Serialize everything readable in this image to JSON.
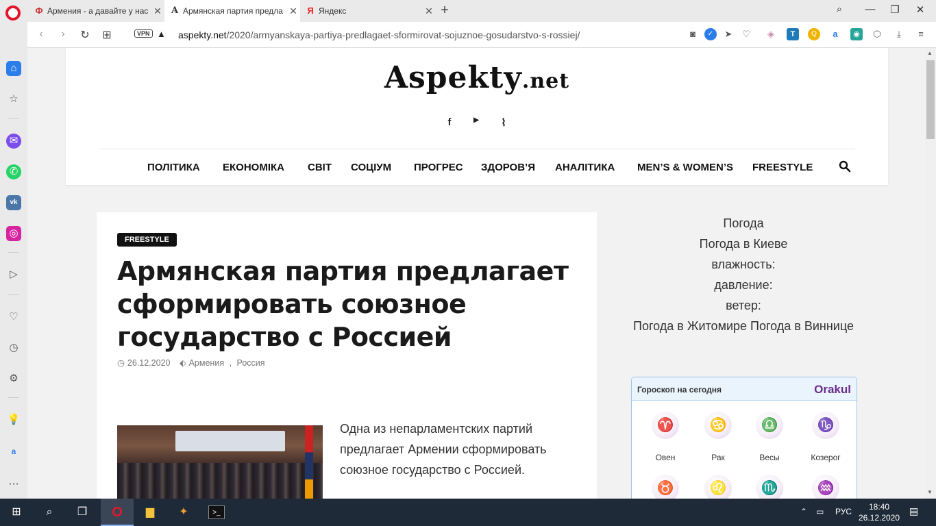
{
  "browser": {
    "tabs": [
      {
        "title": "Армения - а давайте у нас",
        "favicon": "Ф"
      },
      {
        "title": "Армянская партия предла",
        "favicon": "A"
      },
      {
        "title": "Яндекс",
        "favicon": "Я"
      }
    ],
    "new_tab": "+",
    "address": {
      "vpn": "VPN",
      "domain": "aspekty.net",
      "path": "/2020/armyanskaya-partiya-predlagaet-sformirovat-sojuznoe-gosudarstvo-s-rossiej/"
    }
  },
  "site": {
    "logo_main": "Aspekty",
    "logo_tld": ".net",
    "menu": [
      "ПОЛІТИКА",
      "ЕКОНОМІКА",
      "СВІТ",
      "СОЦІУМ",
      "ПРОГРЕС",
      "ЗДОРОВ’Я",
      "АНАЛІТИКА",
      "MEN’S & WOMEN’S",
      "FREESTYLE"
    ]
  },
  "article": {
    "category": "FREESTYLE",
    "title": "Армянская партия предлагает сформировать союзное государство с Россией",
    "date": "26.12.2020",
    "tags": [
      "Армения",
      "Россия"
    ],
    "tag_sep": ",",
    "lead": "Одна из непарламентских партий предлагает Армении сформировать союзное государство с Россией."
  },
  "weather": {
    "lines": [
      "Погода",
      "Погода в Киеве",
      "влажность:",
      "давление:",
      "ветер:",
      "Погода в Житомире Погода в Виннице"
    ]
  },
  "horoscope": {
    "title": "Гороскоп на сегодня",
    "brand": "Orakul",
    "signs": [
      {
        "label": "Овен",
        "glyph": "♈"
      },
      {
        "label": "Рак",
        "glyph": "♋"
      },
      {
        "label": "Весы",
        "glyph": "♎"
      },
      {
        "label": "Козерог",
        "glyph": "♑"
      },
      {
        "label": "",
        "glyph": "♉"
      },
      {
        "label": "",
        "glyph": "♌"
      },
      {
        "label": "",
        "glyph": "♏"
      },
      {
        "label": "",
        "glyph": "♒"
      }
    ]
  },
  "taskbar": {
    "lang": "РУС",
    "time": "18:40",
    "date": "26.12.2020"
  },
  "colors": {
    "opera_red": "#e3172b",
    "taskbar": "#1f2a38",
    "orakul_purple": "#6b2d8a"
  }
}
